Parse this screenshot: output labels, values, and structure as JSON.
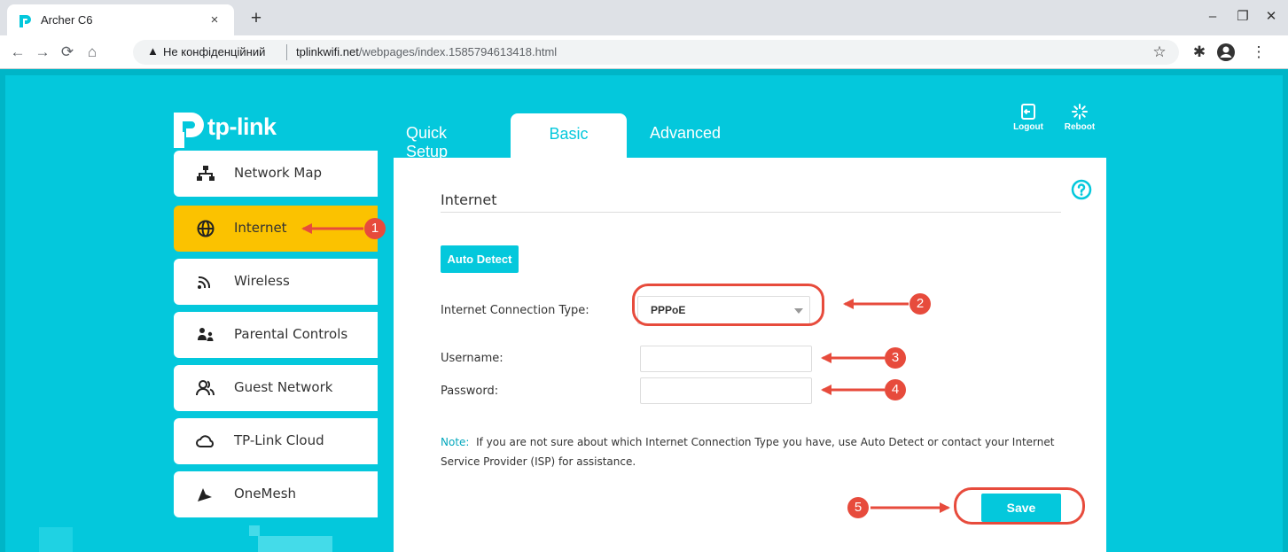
{
  "browser": {
    "tab_title": "Archer C6",
    "tab_close": "×",
    "new_tab": "+",
    "window_controls": {
      "minimize": "–",
      "restore": "❐",
      "close": "✕"
    },
    "security_label": "Не конфіденційний",
    "url_domain": "tplinkwifi.net",
    "url_path": "/webpages/index.1585794613418.html"
  },
  "header": {
    "logo_text": "tp-link",
    "tabs": {
      "quick_setup": "Quick Setup",
      "basic": "Basic",
      "advanced": "Advanced"
    },
    "active_tab": "Basic",
    "logout_label": "Logout",
    "reboot_label": "Reboot"
  },
  "sidebar": {
    "items": [
      {
        "label": "Network Map",
        "icon": "network-map-icon"
      },
      {
        "label": "Internet",
        "icon": "globe-icon",
        "active": true
      },
      {
        "label": "Wireless",
        "icon": "wifi-icon"
      },
      {
        "label": "Parental Controls",
        "icon": "parental-controls-icon"
      },
      {
        "label": "Guest Network",
        "icon": "guest-network-icon"
      },
      {
        "label": "TP-Link Cloud",
        "icon": "cloud-icon"
      },
      {
        "label": "OneMesh",
        "icon": "onemesh-icon"
      }
    ]
  },
  "content": {
    "title": "Internet",
    "auto_detect": "Auto Detect",
    "connection_type_label": "Internet Connection Type:",
    "connection_type_value": "PPPoE",
    "username_label": "Username:",
    "password_label": "Password:",
    "note_prefix": "Note:",
    "note_text": "If you are not sure about which Internet Connection Type you have, use Auto Detect or contact your Internet Service Provider (ISP) for assistance.",
    "save": "Save"
  },
  "annotations": {
    "steps": [
      "1",
      "2",
      "3",
      "4",
      "5"
    ]
  },
  "colors": {
    "brand": "#04c8dc",
    "active_menu": "#fbc200",
    "annotation": "#e74b3c"
  }
}
